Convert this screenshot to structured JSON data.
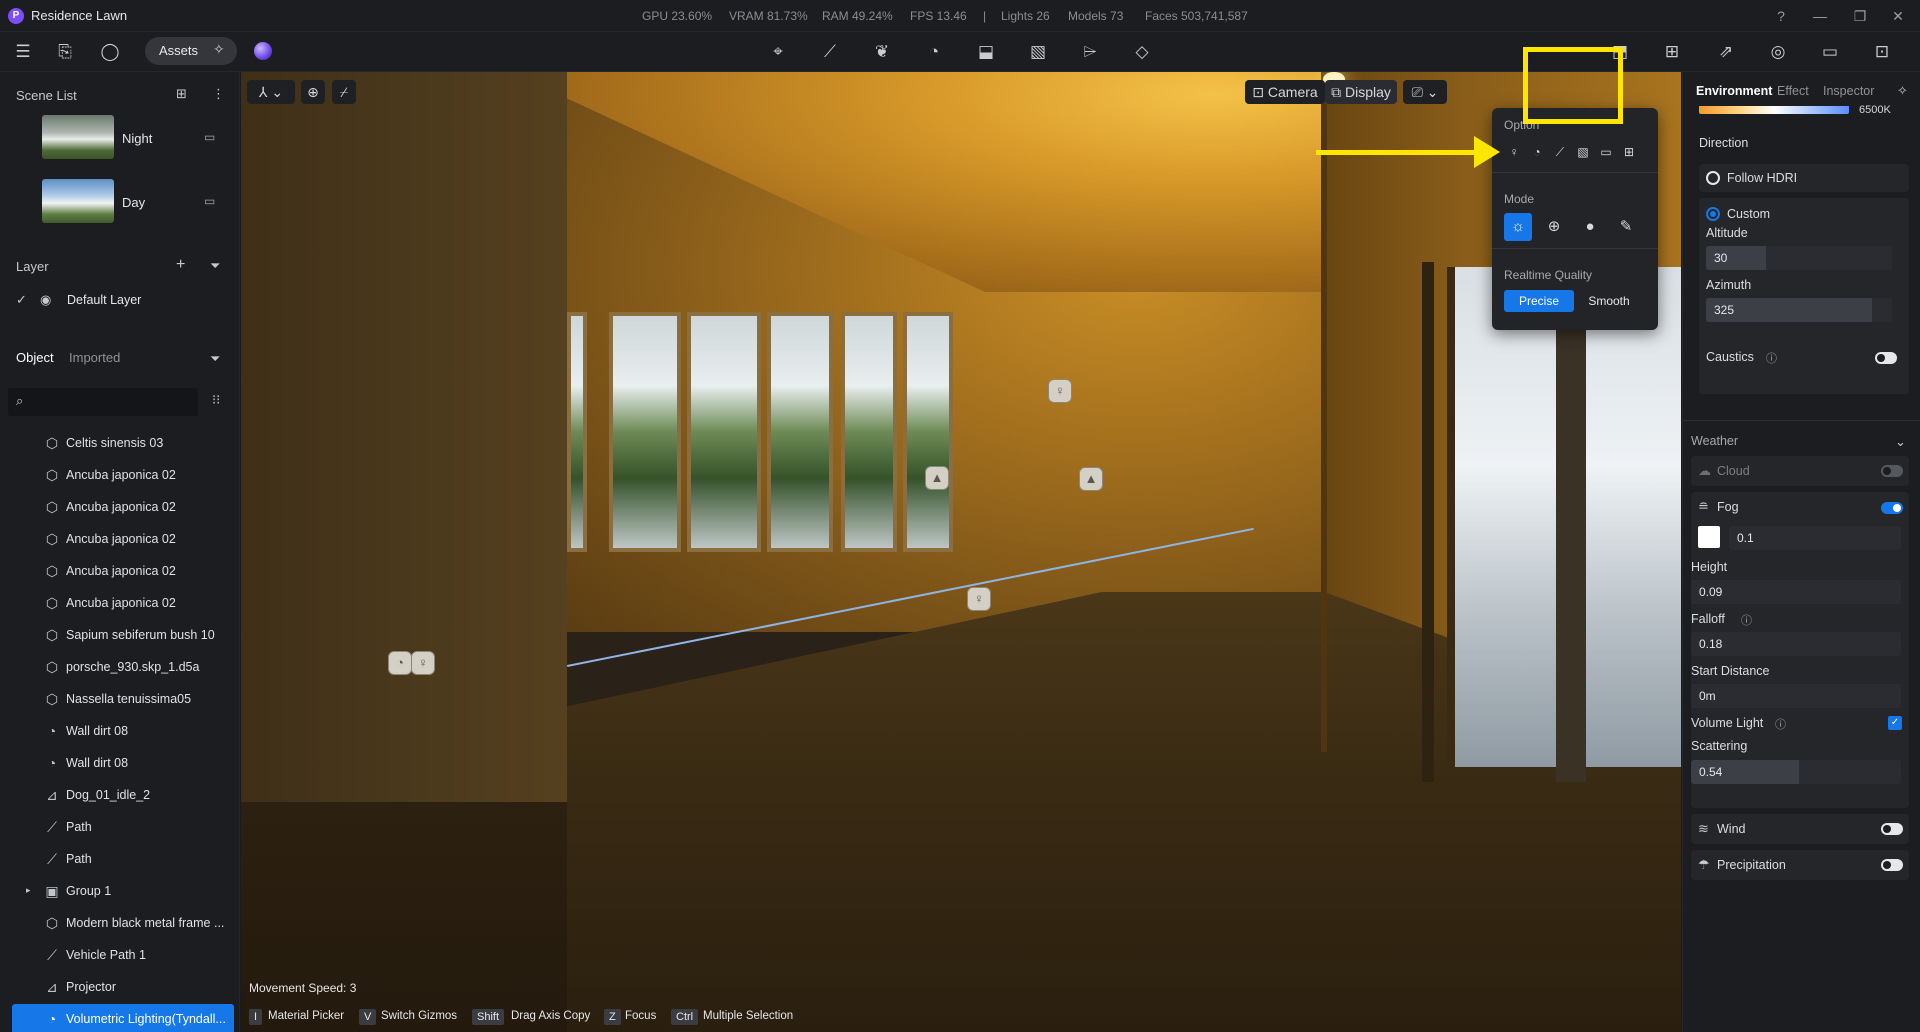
{
  "app": {
    "title": "Residence Lawn",
    "logo": "P"
  },
  "stats": [
    "GPU 23.60%",
    "VRAM 81.73%",
    "RAM 49.24%",
    "FPS 13.46",
    "|",
    "Lights 26",
    "Models 73",
    "Faces 503,741,587"
  ],
  "toolbar": {
    "assets_label": "Assets"
  },
  "left": {
    "scene_list_title": "Scene List",
    "scenes": [
      {
        "name": "Night"
      },
      {
        "name": "Day"
      }
    ],
    "layer_title": "Layer",
    "default_layer": "Default Layer",
    "tab_object": "Object",
    "tab_imported": "Imported",
    "objects": [
      {
        "label": "Celtis sinensis 03",
        "icon": "⬡"
      },
      {
        "label": "Ancuba japonica 02",
        "icon": "⬡"
      },
      {
        "label": "Ancuba japonica 02",
        "icon": "⬡"
      },
      {
        "label": "Ancuba japonica 02",
        "icon": "⬡"
      },
      {
        "label": "Ancuba japonica 02",
        "icon": "⬡"
      },
      {
        "label": "Ancuba japonica 02",
        "icon": "⬡"
      },
      {
        "label": "Sapium sebiferum bush 10",
        "icon": "⬡"
      },
      {
        "label": "porsche_930.skp_1.d5a",
        "icon": "⬡"
      },
      {
        "label": "Nassella tenuissima05",
        "icon": "⬡"
      },
      {
        "label": "Wall dirt 08",
        "icon": "◔"
      },
      {
        "label": "Wall dirt 08",
        "icon": "◔"
      },
      {
        "label": "Dog_01_idle_2",
        "icon": "⊿"
      },
      {
        "label": "Path",
        "icon": "⟋"
      },
      {
        "label": "Path",
        "icon": "⟋"
      },
      {
        "label": "Group 1",
        "icon": "▣"
      },
      {
        "label": "Modern black metal frame ...",
        "icon": "⬡"
      },
      {
        "label": "Vehicle Path 1",
        "icon": "⟋"
      },
      {
        "label": "Projector",
        "icon": "⊿"
      },
      {
        "label": "Volumetric Lighting(Tyndall...",
        "icon": "◔"
      }
    ]
  },
  "viewport": {
    "movement_speed": "Movement Speed: 3",
    "camera_label": "Camera",
    "display_label": "Display",
    "hints": [
      {
        "key": "I",
        "text": "Material Picker"
      },
      {
        "key": "V",
        "text": "Switch Gizmos"
      },
      {
        "key": "Shift",
        "text": "Drag Axis Copy"
      },
      {
        "key": "Z",
        "text": "Focus"
      },
      {
        "key": "Ctrl",
        "text": "Multiple Selection"
      }
    ]
  },
  "display_menu": {
    "option_label": "Option",
    "mode_label": "Mode",
    "quality_label": "Realtime Quality",
    "quality_precise": "Precise",
    "quality_smooth": "Smooth"
  },
  "right": {
    "tabs": [
      "Environment",
      "Effect",
      "Inspector"
    ],
    "temperature": "6500K",
    "direction_label": "Direction",
    "follow_hdri": "Follow HDRI",
    "custom": "Custom",
    "altitude_label": "Altitude",
    "altitude_value": "30",
    "azimuth_label": "Azimuth",
    "azimuth_value": "325",
    "caustics_label": "Caustics",
    "weather_label": "Weather",
    "cloud_label": "Cloud",
    "fog_label": "Fog",
    "fog_value": "0.1",
    "height_label": "Height",
    "height_value": "0.09",
    "falloff_label": "Falloff",
    "falloff_value": "0.18",
    "start_distance_label": "Start Distance",
    "start_distance_value": "0m",
    "volume_light_label": "Volume Light",
    "scattering_label": "Scattering",
    "scattering_value": "0.54",
    "wind_label": "Wind",
    "precipitation_label": "Precipitation",
    "accent_color": "#1677e8",
    "highlight_color": "#ffe600"
  }
}
